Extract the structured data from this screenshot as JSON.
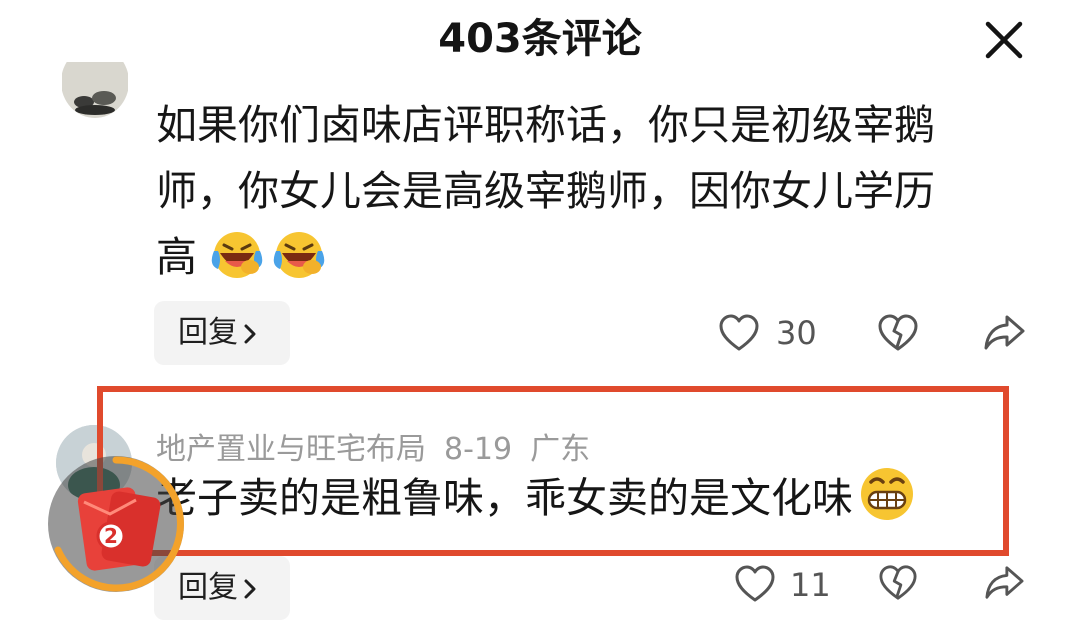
{
  "header": {
    "title": "403条评论",
    "close_icon": "close-icon"
  },
  "comment1": {
    "lines": [
      "如果你们卤味店评职称话，你只是初级宰鹅",
      "师，你女儿会是高级宰鹅师，因你女儿学历",
      "高"
    ],
    "emojis": [
      "laughing-crying-emoji",
      "laughing-crying-emoji"
    ],
    "reply_label": "回复",
    "like_count": "30"
  },
  "comment2": {
    "username": "地产置业与旺宅布局",
    "date": "8-19",
    "location": "广东",
    "text": "老子卖的是粗鲁味，乖女卖的是文化味",
    "emoji": "grinning-emoji",
    "reply_label": "回复",
    "like_count": "11"
  },
  "widget": {
    "badge": "2",
    "icon": "red-packet-icon"
  },
  "colors": {
    "highlight": "#e04a2d",
    "meta": "#9a9a9a",
    "reply_bg": "#f3f3f3"
  }
}
